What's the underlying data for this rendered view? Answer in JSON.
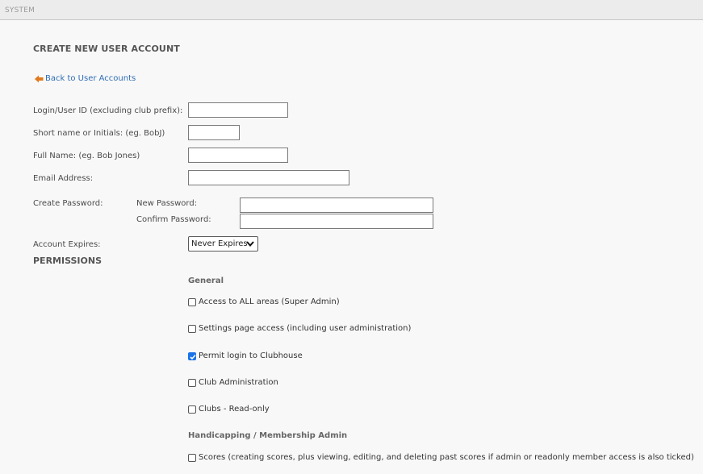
{
  "topbar": {
    "crumb": "SYSTEM"
  },
  "page": {
    "title": "CREATE NEW USER ACCOUNT"
  },
  "back_link": {
    "label": "Back to User Accounts"
  },
  "form": {
    "login_label": "Login/User ID (excluding club prefix):",
    "login_value": "",
    "short_label": "Short name or Initials: (eg. BobJ)",
    "short_value": "",
    "fullname_label": "Full Name: (eg. Bob Jones)",
    "fullname_value": "",
    "email_label": "Email Address:",
    "email_value": "",
    "password_label": "Create Password:",
    "new_password_label": "New Password:",
    "confirm_password_label": "Confirm Password:",
    "expires_label": "Account Expires:",
    "expires_value": "Never Expires"
  },
  "permissions": {
    "title": "PERMISSIONS",
    "groups": [
      {
        "title": "General",
        "items": [
          {
            "label": "Access to ALL areas (Super Admin)",
            "checked": false
          },
          {
            "label": "Settings page access (including user administration)",
            "checked": false
          },
          {
            "label": "Permit login to Clubhouse",
            "checked": true
          },
          {
            "label": "Club Administration",
            "checked": false
          },
          {
            "label": "Clubs - Read-only",
            "checked": false
          }
        ]
      },
      {
        "title": "Handicapping / Membership Admin",
        "items": [
          {
            "label": "Scores (creating scores, plus viewing, editing, and deleting past scores if admin or readonly member access is also ticked)",
            "checked": false
          }
        ]
      }
    ]
  },
  "colors": {
    "link": "#2f6db5",
    "back_arrow": "#e07a1f",
    "checkbox_checked": "#1a73e8"
  },
  "icons": {
    "back": "left-arrow-icon",
    "dropdown": "chevron-down-icon",
    "check": "checkmark-icon"
  }
}
